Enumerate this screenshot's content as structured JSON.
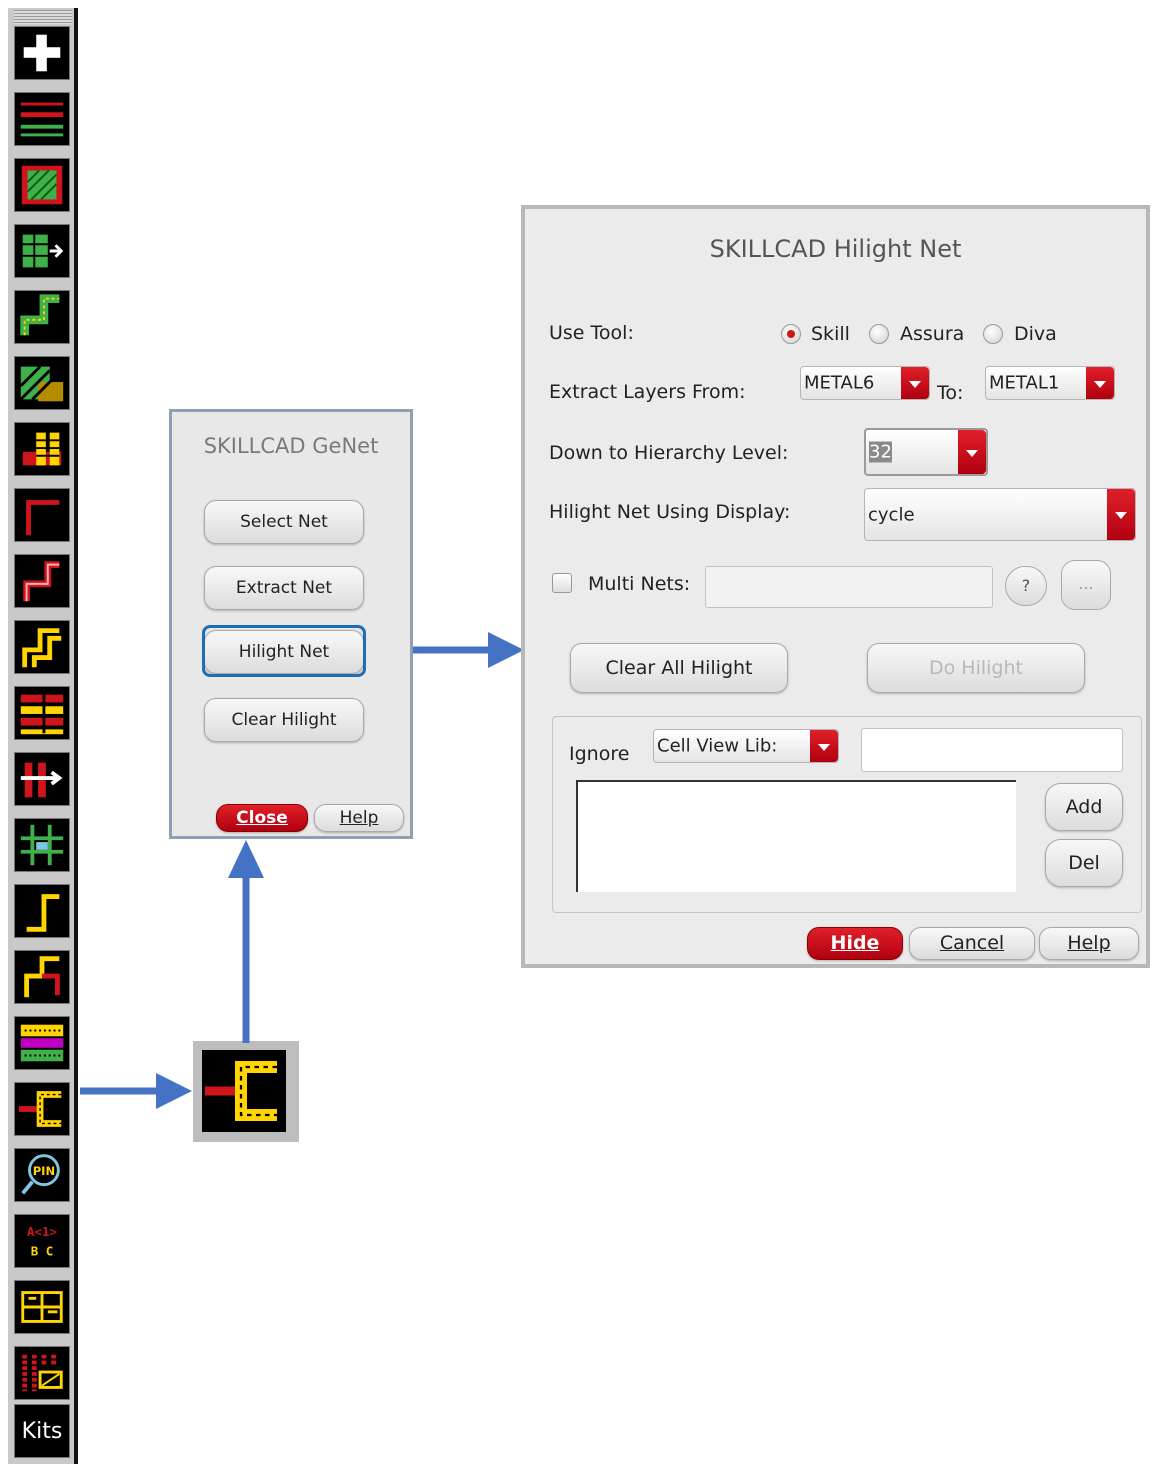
{
  "toolbar": {
    "icons": [
      {
        "name": "add-icon"
      },
      {
        "name": "layer-lines-icon"
      },
      {
        "name": "fill-pattern-icon"
      },
      {
        "name": "move-shape-icon"
      },
      {
        "name": "path-step-icon"
      },
      {
        "name": "hatch-shapes-icon"
      },
      {
        "name": "stack-bars-icon"
      },
      {
        "name": "wire-bend-icon"
      },
      {
        "name": "wire-jog-icon"
      },
      {
        "name": "wire-double-jog-icon"
      },
      {
        "name": "bus-bars-icon"
      },
      {
        "name": "bus-shift-icon"
      },
      {
        "name": "cross-grid-icon"
      },
      {
        "name": "wire-corner-icon"
      },
      {
        "name": "wire-split-icon"
      },
      {
        "name": "via-array-icon"
      },
      {
        "name": "genet-net-icon"
      },
      {
        "name": "pin-search-icon"
      },
      {
        "name": "bus-label-icon"
      },
      {
        "name": "text-grid-icon"
      },
      {
        "name": "array-pattern-icon"
      }
    ],
    "kits_label": "Kits",
    "bus_label_top": "A<1>",
    "bus_label_bottom": "B C",
    "pin_label": "PIN"
  },
  "genet": {
    "title": "SKILLCAD GeNet",
    "buttons": [
      "Select Net",
      "Extract Net",
      "Hilight Net",
      "Clear Hilight"
    ],
    "close_label": "Close",
    "help_label": "Help"
  },
  "hilight": {
    "title": "SKILLCAD Hilight Net",
    "use_tool_label": "Use Tool:",
    "tools": [
      "Skill",
      "Assura",
      "Diva"
    ],
    "selected_tool": "Skill",
    "extract_from_label": "Extract Layers From:",
    "extract_from_value": "METAL6",
    "to_label": "To:",
    "to_value": "METAL1",
    "hierarchy_label": "Down to Hierarchy Level:",
    "hierarchy_value": "32",
    "display_label": "Hilight Net Using Display:",
    "display_value": "cycle",
    "multi_nets_label": "Multi Nets:",
    "multi_nets_value": "",
    "question_label": "?",
    "more_label": "...",
    "clear_all_label": "Clear All Hilight",
    "do_hilight_label": "Do Hilight",
    "ignore_label": "Ignore",
    "ignore_type_value": "Cell View Lib:",
    "ignore_input_value": "",
    "add_label": "Add",
    "del_label": "Del",
    "hide_label": "Hide",
    "cancel_label": "Cancel",
    "help_label": "Help"
  },
  "colors": {
    "accent_red": "#c8101a",
    "arrow_blue": "#4472c4",
    "highlight_frame": "#1e6db5"
  }
}
